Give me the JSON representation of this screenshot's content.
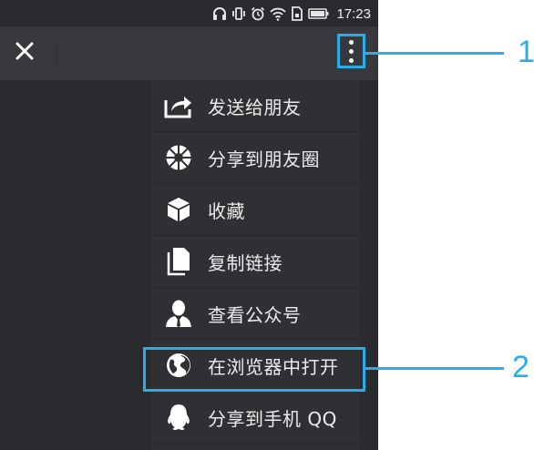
{
  "status_bar": {
    "time": "17:23",
    "icons": [
      "headphones-icon",
      "vibrate-icon",
      "alarm-icon",
      "wifi-icon",
      "sim-icon",
      "battery-icon"
    ]
  },
  "top_bar": {
    "close_icon": "close-icon",
    "more_icon": "more-vertical-icon"
  },
  "menu": {
    "items": [
      {
        "label": "发送给朋友",
        "icon": "share-icon"
      },
      {
        "label": "分享到朋友圈",
        "icon": "moments-icon"
      },
      {
        "label": "收藏",
        "icon": "favorite-cube-icon"
      },
      {
        "label": "复制链接",
        "icon": "copy-icon"
      },
      {
        "label": "查看公众号",
        "icon": "official-account-icon"
      },
      {
        "label": "在浏览器中打开",
        "icon": "globe-icon"
      },
      {
        "label": "分享到手机 QQ",
        "icon": "qq-icon"
      }
    ]
  },
  "callouts": [
    {
      "number": "1"
    },
    {
      "number": "2"
    }
  ],
  "colors": {
    "accent": "#27aee6",
    "background": "#2a2b2f",
    "topbar": "#38393d",
    "menu": "#2f3034",
    "text": "#ececec"
  }
}
